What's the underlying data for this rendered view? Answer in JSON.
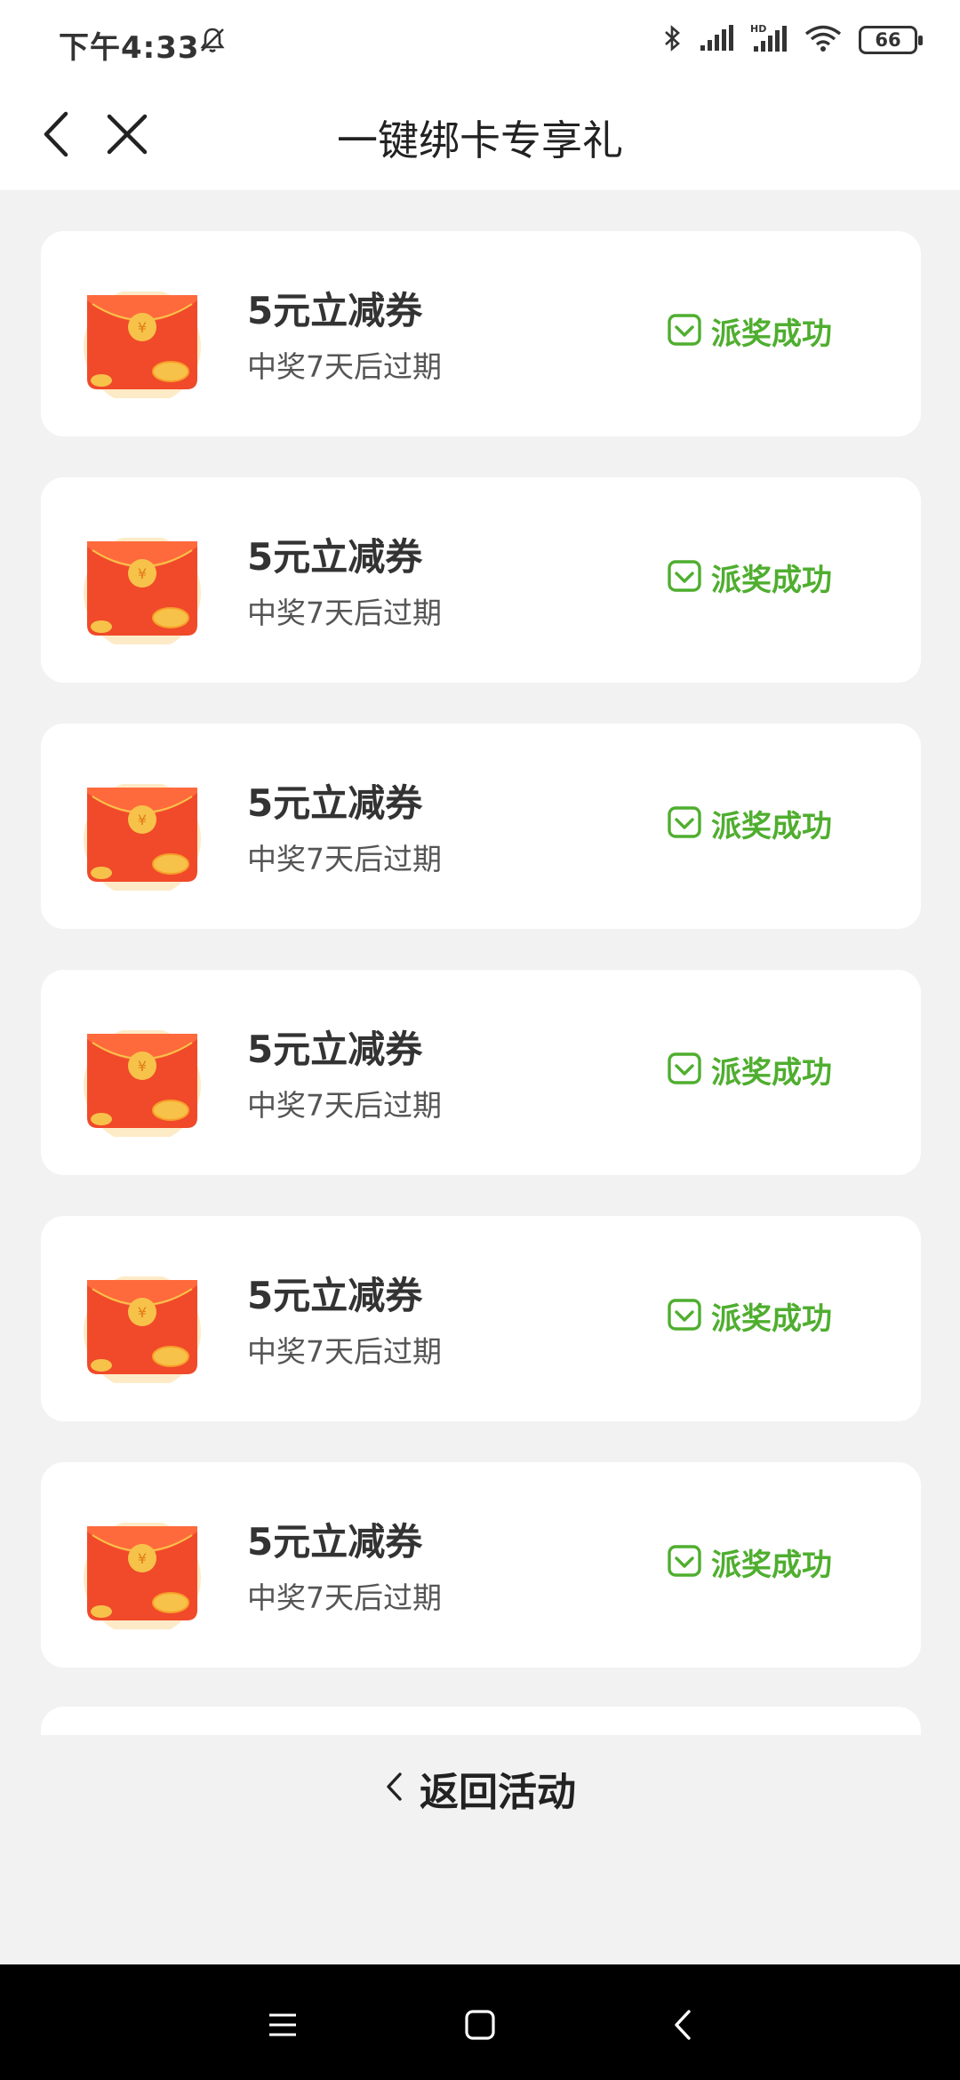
{
  "status_bar": {
    "time": "下午4:33",
    "battery": "66",
    "icons": [
      "bell-off-icon",
      "bluetooth-icon",
      "signal-icon",
      "hd-signal-icon",
      "wifi-icon",
      "battery-icon"
    ]
  },
  "nav": {
    "title": "一键绑卡专享礼",
    "back_icon": "chevron-left-icon",
    "close_icon": "close-icon"
  },
  "coupons": [
    {
      "title": "5元立减券",
      "subtitle": "中奖7天后过期",
      "status": "派奖成功"
    },
    {
      "title": "5元立减券",
      "subtitle": "中奖7天后过期",
      "status": "派奖成功"
    },
    {
      "title": "5元立减券",
      "subtitle": "中奖7天后过期",
      "status": "派奖成功"
    },
    {
      "title": "5元立减券",
      "subtitle": "中奖7天后过期",
      "status": "派奖成功"
    },
    {
      "title": "5元立减券",
      "subtitle": "中奖7天后过期",
      "status": "派奖成功"
    },
    {
      "title": "5元立减券",
      "subtitle": "中奖7天后过期",
      "status": "派奖成功"
    }
  ],
  "footer": {
    "return_label": "返回活动"
  },
  "colors": {
    "success_green": "#4fae2f",
    "envelope_red": "#f04a2a",
    "coin_gold": "#f7c24a",
    "background": "#f2f2f2"
  }
}
